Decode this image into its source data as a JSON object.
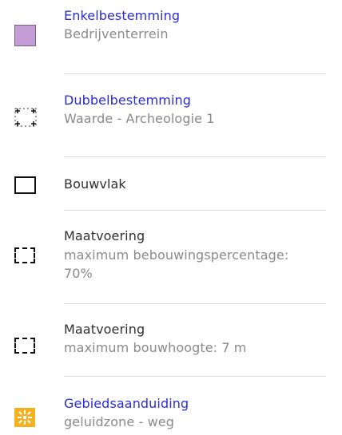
{
  "legend": {
    "items": [
      {
        "title": "Enkelbestemming",
        "subtitle": "Bedrijventerrein",
        "symbol_icon": "purple-fill-square-icon",
        "symbol_color": "#c39ed6",
        "title_color": "#2b2bdc"
      },
      {
        "title": "Dubbelbestemming",
        "subtitle": "Waarde - Archeologie 1",
        "symbol_icon": "cross-corners-square-icon",
        "title_color": "#2b2bdc"
      },
      {
        "title": "Bouwvlak",
        "symbol_icon": "solid-outline-square-icon"
      },
      {
        "title": "Maatvoering",
        "subtitle_line1": "maximum bebouwingspercentage:",
        "subtitle_line2": "70%",
        "symbol_icon": "dashed-outline-square-icon"
      },
      {
        "title": "Maatvoering",
        "subtitle": "maximum bouwhoogte: 7 m",
        "symbol_icon": "dashed-outline-square-icon"
      },
      {
        "title": "Gebiedsaanduiding",
        "subtitle": "geluidzone - weg",
        "symbol_icon": "orange-pattern-square-icon",
        "symbol_color": "#f5b01f",
        "title_color": "#2b2bdc"
      }
    ]
  }
}
